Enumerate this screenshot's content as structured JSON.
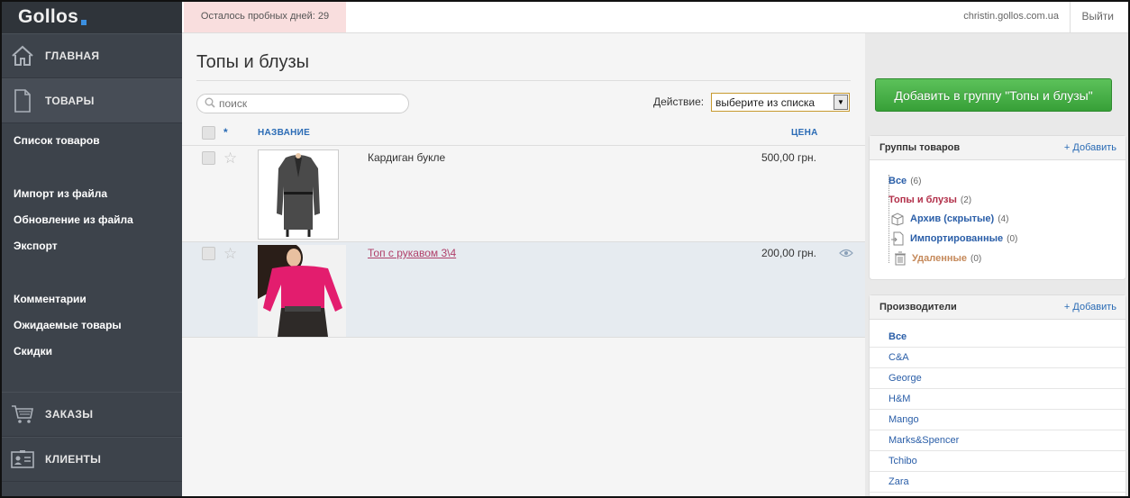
{
  "app": {
    "logo": "Gollos"
  },
  "topbar": {
    "trial_text": "Осталось пробных дней: 29",
    "domain": "christin.gollos.com.ua",
    "logout": "Выйти"
  },
  "sidebar": {
    "main_nav": [
      {
        "label": "ГЛАВНАЯ",
        "icon": "home-icon"
      },
      {
        "label": "ТОВАРЫ",
        "icon": "document-icon"
      }
    ],
    "sub_items": [
      "Список товаров",
      "Импорт из файла",
      "Обновление из файла",
      "Экспорт",
      "Комментарии",
      "Ожидаемые товары",
      "Скидки"
    ],
    "bottom_nav": [
      {
        "label": "ЗАКАЗЫ",
        "icon": "cart-icon"
      },
      {
        "label": "КЛИЕНТЫ",
        "icon": "contact-card-icon"
      }
    ]
  },
  "main": {
    "title": "Топы и блузы",
    "search_placeholder": "поиск",
    "action_label": "Действие:",
    "action_select_value": "выберите из списка",
    "columns": {
      "star": "*",
      "name": "НАЗВАНИЕ",
      "price": "ЦЕНА"
    },
    "rows": [
      {
        "name": "Кардиган букле",
        "price": "500,00 грн.",
        "link": false,
        "highlight": false
      },
      {
        "name": "Топ с рукавом 3\\4",
        "price": "200,00 грн.",
        "link": true,
        "highlight": true
      }
    ]
  },
  "right": {
    "add_button": "Добавить в группу \"Топы и блузы\"",
    "groups": {
      "title": "Группы товаров",
      "add": "+ Добавить",
      "items": [
        {
          "label": "Все",
          "count": "(6)"
        },
        {
          "label": "Топы и блузы",
          "count": "(2)"
        },
        {
          "label": "Архив (скрытые)",
          "count": "(4)",
          "icon": "box-icon"
        },
        {
          "label": "Импортированные",
          "count": "(0)",
          "icon": "import-icon"
        },
        {
          "label": "Удаленные",
          "count": "(0)",
          "icon": "trash-icon"
        }
      ]
    },
    "manufacturers": {
      "title": "Производители",
      "add": "+ Добавить",
      "items": [
        "Все",
        "C&A",
        "George",
        "H&M",
        "Mango",
        "Marks&Spencer",
        "Tchibo",
        "Zara"
      ]
    }
  },
  "colors": {
    "sidebar_bg": "#3d434b",
    "accent_blue": "#2a6bb5",
    "add_green": "#37a038",
    "link_red": "#b0406a",
    "trial_bg": "#f9dede"
  }
}
